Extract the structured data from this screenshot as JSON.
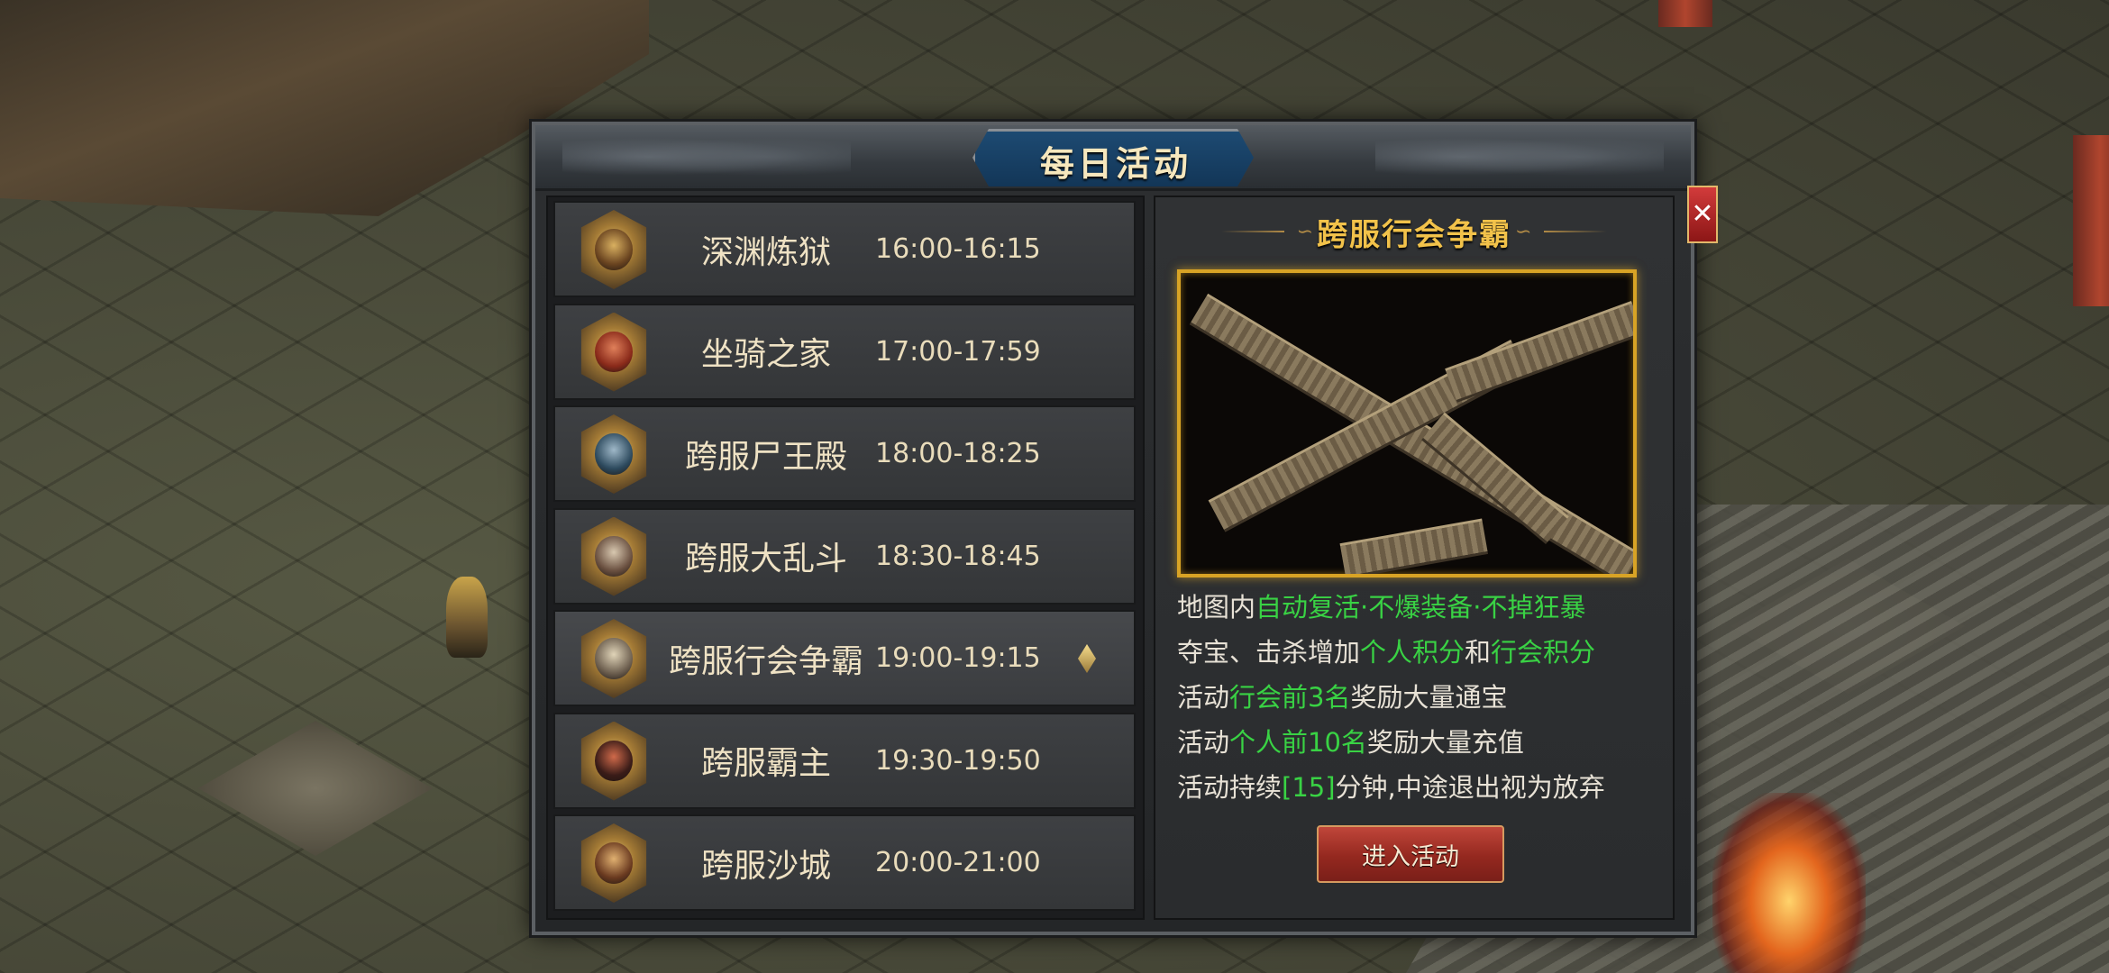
{
  "window_title": "每日活动",
  "activities": [
    {
      "name": "深渊炼狱",
      "time": "16:00-16:15",
      "icon": "skull-emblem-icon",
      "c1": "#d9b060",
      "c2": "#6a4420"
    },
    {
      "name": "坐骑之家",
      "time": "17:00-17:59",
      "icon": "mount-emblem-icon",
      "c1": "#e0805a",
      "c2": "#8a2a1a"
    },
    {
      "name": "跨服尸王殿",
      "time": "18:00-18:25",
      "icon": "zombie-king-emblem-icon",
      "c1": "#9fb8c8",
      "c2": "#2d4a5e"
    },
    {
      "name": "跨服大乱斗",
      "time": "18:30-18:45",
      "icon": "crossed-swords-emblem-icon",
      "c1": "#d8c8b0",
      "c2": "#6a5040"
    },
    {
      "name": "跨服行会争霸",
      "time": "19:00-19:15",
      "icon": "guild-war-emblem-icon",
      "c1": "#e0d4b8",
      "c2": "#6e6050"
    },
    {
      "name": "跨服霸主",
      "time": "19:30-19:50",
      "icon": "overlord-emblem-icon",
      "c1": "#d06a4a",
      "c2": "#3a1c18"
    },
    {
      "name": "跨服沙城",
      "time": "20:00-21:00",
      "icon": "castle-gate-emblem-icon",
      "c1": "#e0b070",
      "c2": "#6a3a20"
    }
  ],
  "selected_index": 4,
  "detail": {
    "title": "跨服行会争霸",
    "lines": [
      [
        {
          "t": "地图内",
          "hl": false
        },
        {
          "t": "自动复活·不爆装备·不掉狂暴",
          "hl": true
        }
      ],
      [
        {
          "t": "夺宝、击杀增加",
          "hl": false
        },
        {
          "t": "个人积分",
          "hl": true
        },
        {
          "t": "和",
          "hl": false
        },
        {
          "t": "行会积分",
          "hl": true
        }
      ],
      [
        {
          "t": "活动",
          "hl": false
        },
        {
          "t": "行会前3名",
          "hl": true
        },
        {
          "t": "奖励大量通宝",
          "hl": false
        }
      ],
      [
        {
          "t": "活动",
          "hl": false
        },
        {
          "t": "个人前10名",
          "hl": true
        },
        {
          "t": "奖励大量充值",
          "hl": false
        }
      ],
      [
        {
          "t": "活动持续",
          "hl": false
        },
        {
          "t": "[15]",
          "hl": true
        },
        {
          "t": "分钟,中途退出视为放弃",
          "hl": false
        }
      ]
    ],
    "enter_button": "进入活动"
  },
  "close_button": "✕",
  "colors": {
    "highlight_green": "#39d244",
    "title_gold": "#f2c24a",
    "map_border": "#d8a325",
    "button_red": "#94281f"
  }
}
